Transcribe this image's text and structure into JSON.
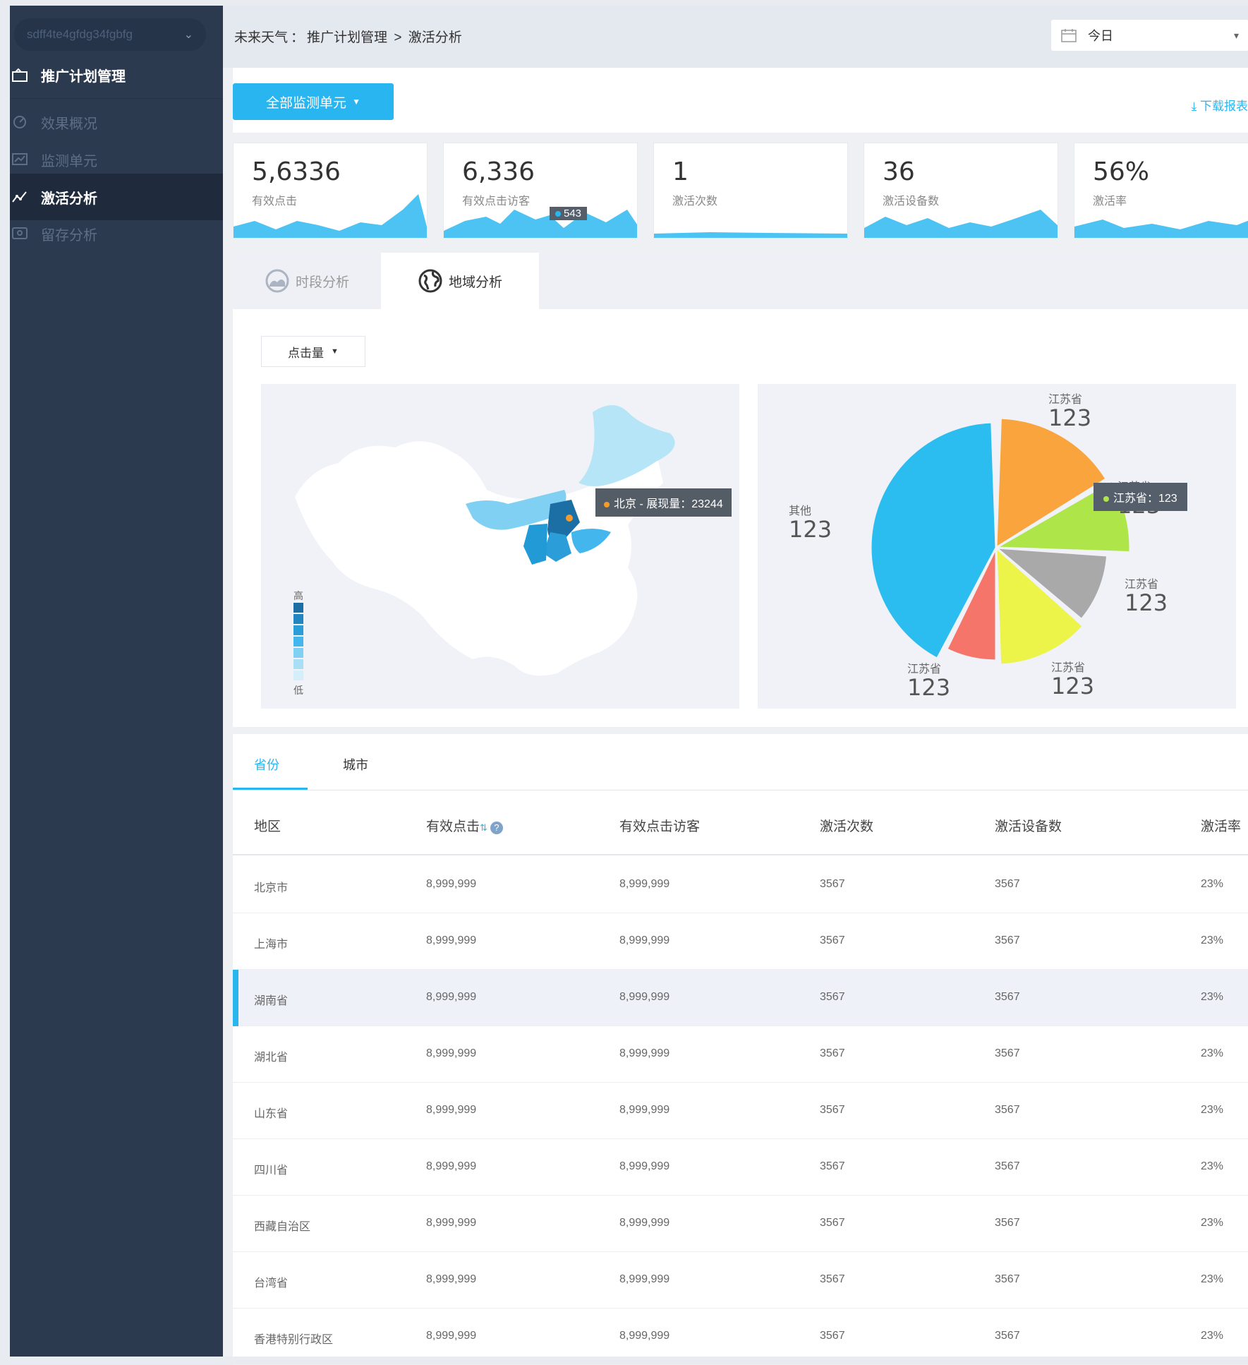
{
  "sidebar": {
    "account": "sdff4te4gfdg34fgbfg",
    "items": [
      {
        "label": "推广计划管理"
      },
      {
        "label": "效果概况"
      },
      {
        "label": "监测单元"
      },
      {
        "label": "激活分析"
      },
      {
        "label": "留存分析"
      }
    ]
  },
  "header": {
    "breadcrumb": [
      "未来天气",
      "：",
      "推广计划管理",
      ">",
      "激活分析"
    ],
    "date_value": "今日"
  },
  "actions": {
    "unit_button": "全部监测单元",
    "download": "下载报表"
  },
  "kpis": [
    {
      "value": "5,6336",
      "label": "有效点击"
    },
    {
      "value": "6,336",
      "label": "有效点击访客",
      "tooltip": "543"
    },
    {
      "value": "1",
      "label": "激活次数"
    },
    {
      "value": "36",
      "label": "激活设备数"
    },
    {
      "value": "56%",
      "label": "激活率"
    }
  ],
  "analysis": {
    "tabs": [
      "时段分析",
      "地域分析"
    ],
    "metric": "点击量",
    "map_tooltip": "北京 - 展现量：23244",
    "legend_high": "高",
    "legend_low": "低",
    "pie_tooltip": "江苏省：123",
    "pie_labels": [
      {
        "name": "江苏省",
        "value": "123"
      },
      {
        "name": "江苏省",
        "value": "123"
      },
      {
        "name": "江苏省",
        "value": "123"
      },
      {
        "name": "江苏省",
        "value": "123"
      },
      {
        "name": "江苏省",
        "value": "123"
      },
      {
        "name": "其他",
        "value": "123"
      }
    ]
  },
  "chart_data": {
    "type": "pie",
    "slices": [
      {
        "label": "江苏省",
        "value": 123,
        "color": "#f9a43d"
      },
      {
        "label": "江苏省",
        "value": 123,
        "color": "#aee64a"
      },
      {
        "label": "江苏省",
        "value": 123,
        "color": "#a9a9a9"
      },
      {
        "label": "江苏省",
        "value": 123,
        "color": "#ecf44a"
      },
      {
        "label": "江苏省",
        "value": 123,
        "color": "#f5756b"
      },
      {
        "label": "其他",
        "value": 123,
        "color": "#2bbcf0"
      }
    ]
  },
  "table": {
    "tabs": [
      "省份",
      "城市"
    ],
    "headers": [
      "地区",
      "有效点击",
      "有效点击访客",
      "激活次数",
      "激活设备数",
      "激活率"
    ],
    "rows": [
      [
        "北京市",
        "8,999,999",
        "8,999,999",
        "3567",
        "3567",
        "23%"
      ],
      [
        "上海市",
        "8,999,999",
        "8,999,999",
        "3567",
        "3567",
        "23%"
      ],
      [
        "湖南省",
        "8,999,999",
        "8,999,999",
        "3567",
        "3567",
        "23%"
      ],
      [
        "湖北省",
        "8,999,999",
        "8,999,999",
        "3567",
        "3567",
        "23%"
      ],
      [
        "山东省",
        "8,999,999",
        "8,999,999",
        "3567",
        "3567",
        "23%"
      ],
      [
        "四川省",
        "8,999,999",
        "8,999,999",
        "3567",
        "3567",
        "23%"
      ],
      [
        "西藏自治区",
        "8,999,999",
        "8,999,999",
        "3567",
        "3567",
        "23%"
      ],
      [
        "台湾省",
        "8,999,999",
        "8,999,999",
        "3567",
        "3567",
        "23%"
      ],
      [
        "香港特别行政区",
        "8,999,999",
        "8,999,999",
        "3567",
        "3567",
        "23%"
      ]
    ]
  },
  "colors": {
    "accent": "#29b6f0",
    "sidebar": "#2b3a4f",
    "sidebar_active": "#1f2b3c"
  }
}
